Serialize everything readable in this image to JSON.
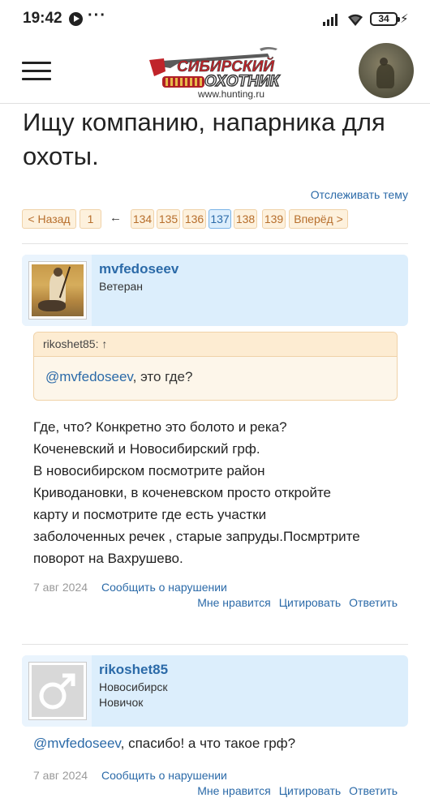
{
  "status_bar": {
    "time": "19:42",
    "dots": "···",
    "battery": "34"
  },
  "header": {
    "logo_line1": "СИБИРСКИЙ",
    "logo_line2": "ОХОТНИК",
    "logo_url": "www.hunting.ru"
  },
  "page": {
    "title": "Ищу компанию, напарника для охоты.",
    "track_label": "Отслеживать тему"
  },
  "pagination": {
    "prev": "< Назад",
    "first": "1",
    "gap": "←",
    "pages": [
      "134",
      "135",
      "136",
      "137",
      "138",
      "139"
    ],
    "current": "137",
    "next": "Вперёд >"
  },
  "posts": [
    {
      "username": "mvfedoseev",
      "rank": "Ветеран",
      "quote_author": "rikoshet85: ↑",
      "quote_mention": "@mvfedoseev",
      "quote_text": ", это где?",
      "text_lines": [
        "Где, что? Конкретно это болото и река?",
        "Коченевский и Новосибирский грф.",
        "В новосибирском посмотрите район",
        "Криводановки, в коченевском просто откройте",
        "карту и посмотрите где есть участки",
        "заболоченных речек , старые запруды.Посмртрите",
        "поворот на Вахрушево."
      ],
      "date": "7 авг 2024",
      "report": "Сообщить о нарушении",
      "like": "Мне нравится",
      "quote": "Цитировать",
      "reply": "Ответить"
    },
    {
      "username": "rikoshet85",
      "location": "Новосибирск",
      "rank": "Новичок",
      "text_mention": "@mvfedoseev",
      "text": ", спасибо! а что такое грф?",
      "date": "7 авг 2024",
      "report": "Сообщить о нарушении",
      "like": "Мне нравится",
      "quote": "Цитировать",
      "reply": "Ответить"
    }
  ],
  "colors": {
    "link": "#2b6aa8",
    "user_bg": "#dceefc",
    "pager_bg": "#fdf1dd",
    "quote_bg": "#fdf6ea"
  }
}
